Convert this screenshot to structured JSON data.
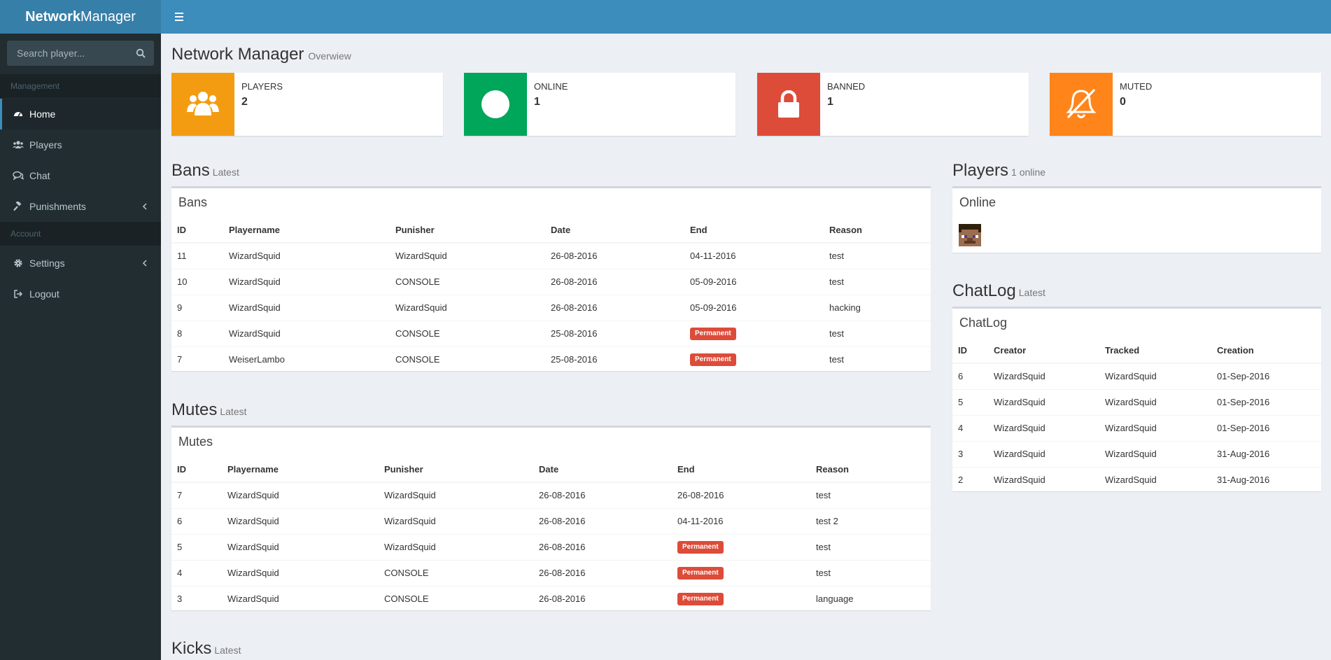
{
  "brand": {
    "bold": "Network",
    "light": "Manager"
  },
  "search": {
    "placeholder": "Search player..."
  },
  "sidebar": {
    "management_header": "Management",
    "account_header": "Account",
    "items": [
      {
        "label": "Home",
        "icon": "dashboard-icon"
      },
      {
        "label": "Players",
        "icon": "users-icon"
      },
      {
        "label": "Chat",
        "icon": "chat-icon"
      },
      {
        "label": "Punishments",
        "icon": "gavel-icon"
      },
      {
        "label": "Settings",
        "icon": "gear-icon"
      },
      {
        "label": "Logout",
        "icon": "logout-icon"
      }
    ]
  },
  "page": {
    "title": "Network Manager",
    "subtitle": "Overwiew"
  },
  "stats": [
    {
      "label": "PLAYERS",
      "value": "2",
      "color": "#f39c12",
      "icon": "users-icon"
    },
    {
      "label": "ONLINE",
      "value": "1",
      "color": "#00a65a",
      "icon": "circle-icon"
    },
    {
      "label": "BANNED",
      "value": "1",
      "color": "#dd4b39",
      "icon": "lock-icon"
    },
    {
      "label": "MUTED",
      "value": "0",
      "color": "#ff851b",
      "icon": "bell-slash-icon"
    }
  ],
  "bans": {
    "section": "Bans",
    "section_sub": "Latest",
    "box_title": "Bans",
    "columns": [
      "ID",
      "Playername",
      "Punisher",
      "Date",
      "End",
      "Reason"
    ],
    "rows": [
      [
        "11",
        "WizardSquid",
        "WizardSquid",
        "26-08-2016",
        "04-11-2016",
        "test"
      ],
      [
        "10",
        "WizardSquid",
        "CONSOLE",
        "26-08-2016",
        "05-09-2016",
        "test"
      ],
      [
        "9",
        "WizardSquid",
        "WizardSquid",
        "26-08-2016",
        "05-09-2016",
        "hacking"
      ],
      [
        "8",
        "WizardSquid",
        "CONSOLE",
        "25-08-2016",
        "Permanent",
        "test"
      ],
      [
        "7",
        "WeiserLambo",
        "CONSOLE",
        "25-08-2016",
        "Permanent",
        "test"
      ]
    ]
  },
  "mutes": {
    "section": "Mutes",
    "section_sub": "Latest",
    "box_title": "Mutes",
    "columns": [
      "ID",
      "Playername",
      "Punisher",
      "Date",
      "End",
      "Reason"
    ],
    "rows": [
      [
        "7",
        "WizardSquid",
        "WizardSquid",
        "26-08-2016",
        "26-08-2016",
        "test"
      ],
      [
        "6",
        "WizardSquid",
        "WizardSquid",
        "26-08-2016",
        "04-11-2016",
        "test 2"
      ],
      [
        "5",
        "WizardSquid",
        "WizardSquid",
        "26-08-2016",
        "Permanent",
        "test"
      ],
      [
        "4",
        "WizardSquid",
        "CONSOLE",
        "26-08-2016",
        "Permanent",
        "test"
      ],
      [
        "3",
        "WizardSquid",
        "CONSOLE",
        "26-08-2016",
        "Permanent",
        "language"
      ]
    ]
  },
  "kicks": {
    "section": "Kicks",
    "section_sub": "Latest"
  },
  "players": {
    "section": "Players",
    "section_sub": "1 online",
    "box_title": "Online"
  },
  "chatlog": {
    "section": "ChatLog",
    "section_sub": "Latest",
    "box_title": "ChatLog",
    "columns": [
      "ID",
      "Creator",
      "Tracked",
      "Creation"
    ],
    "rows": [
      [
        "6",
        "WizardSquid",
        "WizardSquid",
        "01-Sep-2016"
      ],
      [
        "5",
        "WizardSquid",
        "WizardSquid",
        "01-Sep-2016"
      ],
      [
        "4",
        "WizardSquid",
        "WizardSquid",
        "01-Sep-2016"
      ],
      [
        "3",
        "WizardSquid",
        "WizardSquid",
        "31-Aug-2016"
      ],
      [
        "2",
        "WizardSquid",
        "WizardSquid",
        "31-Aug-2016"
      ]
    ]
  },
  "permanent_color": "#dd4b39"
}
